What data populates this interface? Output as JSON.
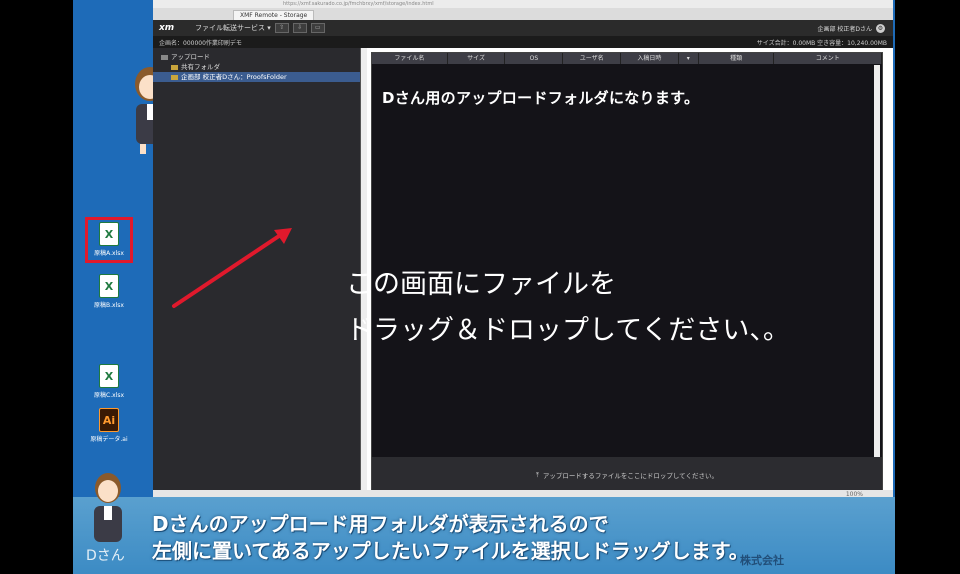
{
  "browser": {
    "address": "https://xmf.sakurado.co.jp/fmchbrxy/xmf/storage/index.html",
    "tab_title": "XMF Remote - Storage"
  },
  "app": {
    "logo": "xm",
    "service_menu": "ファイル転送サービス ▾",
    "user": "企画部 校正者Dさん",
    "breadcrumb": "企画名：000000作業印刷デモ",
    "usage": "サイズ合計：0.00MB  空き容量：10,240.00MB"
  },
  "sidebar": {
    "items": [
      {
        "label": "アップロード"
      },
      {
        "label": "共有フォルダ"
      },
      {
        "label": "企画部 校正者Dさん：ProofsFolder"
      }
    ]
  },
  "table": {
    "columns": [
      "ファイル名",
      "サイズ",
      "OS",
      "ユーザ名",
      "入稿日時",
      "▾",
      "種類",
      "コメント"
    ]
  },
  "main": {
    "heading": "Dさん用のアップロードフォルダになります。",
    "drop_hint": "アップロードするファイルをここにドロップしてください。"
  },
  "footer": {
    "zoom": "100%"
  },
  "desktop": {
    "icons": [
      {
        "label": "原稿A.xlsx"
      },
      {
        "label": "原稿B.xlsx"
      },
      {
        "label": "原稿C.xlsx"
      },
      {
        "label": "原稿データ.ai"
      }
    ]
  },
  "overlay": {
    "line1": "この画面にファイルを",
    "line2": "ドラッグ＆ドロップしてください、。"
  },
  "caption": {
    "speaker": "Dさん",
    "line1": "Dさんのアップロード用フォルダが表示されるので",
    "line2": "左側に置いてあるアップしたいファイルを選択しドラッグします。",
    "watermark": "株式会社"
  },
  "colors": {
    "caption_bg": "#4b96c9",
    "desktop_bg": "#1e6bb8",
    "highlight": "#e0192c",
    "arrow": "#e0192c"
  }
}
